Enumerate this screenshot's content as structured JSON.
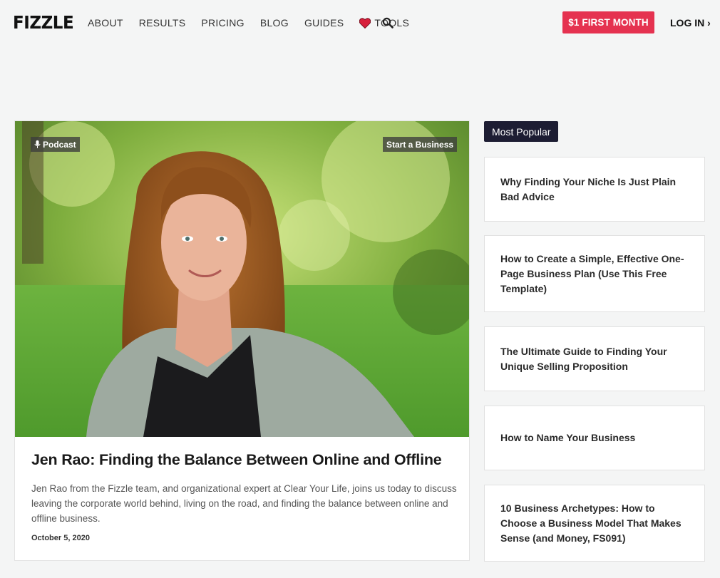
{
  "header": {
    "logo": "FIZZLE",
    "nav": [
      "ABOUT",
      "RESULTS",
      "PRICING",
      "BLOG",
      "GUIDES"
    ],
    "tools_label": "TOOLS",
    "cta_label": "$1 FIRST MONTH",
    "login_label": "LOG IN ›"
  },
  "featured": {
    "tag_podcast": "Podcast",
    "tag_category": "Start a Business",
    "title": "Jen Rao: Finding the Balance Between Online and Offline",
    "excerpt": "Jen Rao from the Fizzle team, and organizational expert at Clear Your Life, joins us today to discuss leaving the corporate world behind, living on the road, and finding the balance between online and offline business.",
    "date": "October 5, 2020"
  },
  "sidebar": {
    "label": "Most Popular",
    "items": [
      "Why Finding Your Niche Is Just Plain Bad Advice",
      "How to Create a Simple, Effective One-Page Business Plan (Use This Free Template)",
      "The Ultimate Guide to Finding Your Unique Selling Proposition",
      "How to Name Your Business",
      "10 Business Archetypes: How to Choose a Business Model That Makes Sense (and Money, FS091)"
    ]
  },
  "colors": {
    "accent": "#e53250",
    "label_bg": "#1d1d33",
    "page_bg": "#f4f5f5"
  }
}
